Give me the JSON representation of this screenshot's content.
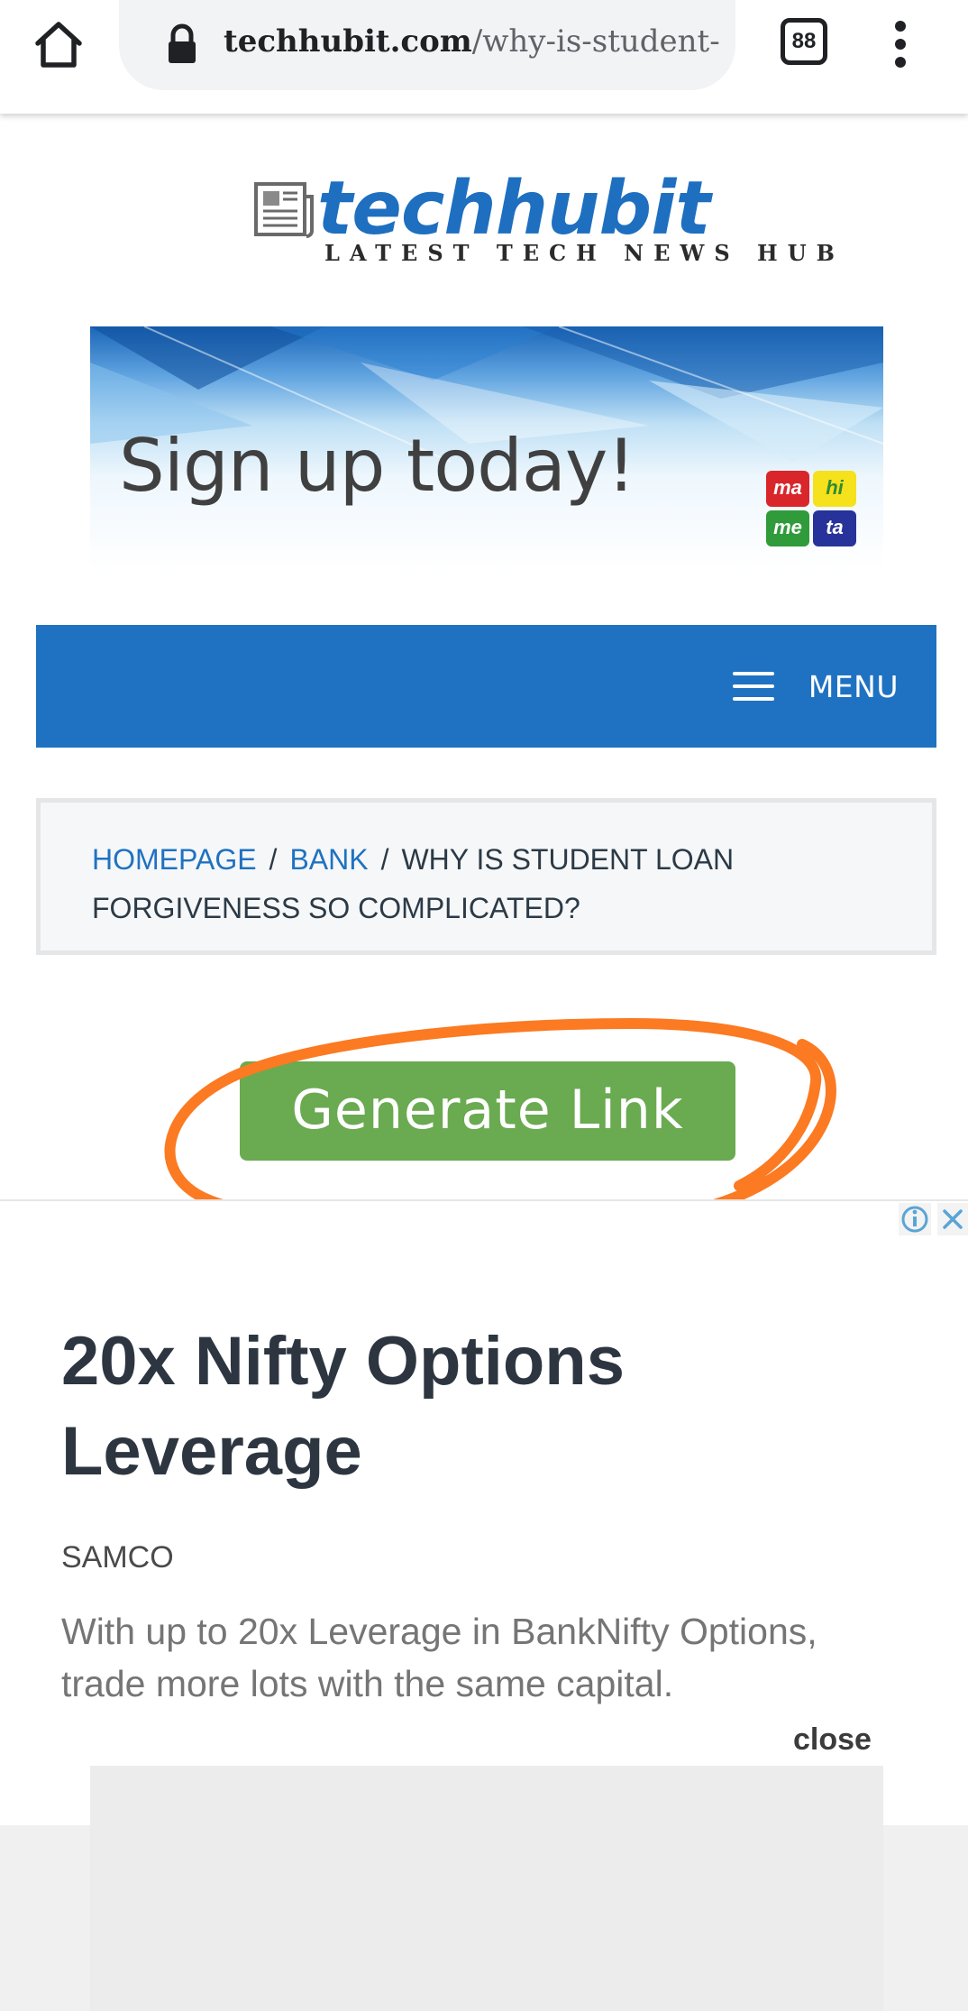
{
  "browser": {
    "url_host": "techhubit.com",
    "url_path": "/why-is-student-",
    "tab_count": "88"
  },
  "site": {
    "logo_name": "techhubit",
    "logo_tagline": "LATEST TECH NEWS HUB"
  },
  "banner": {
    "text": "Sign up today!",
    "logo_tiles": [
      "ma",
      "hi",
      "me",
      "ta"
    ]
  },
  "nav": {
    "menu_label": "MENU"
  },
  "breadcrumb": {
    "items": [
      "HOMEPAGE",
      "BANK"
    ],
    "separator": "/",
    "current_line1": "WHY IS STUDENT LOAN",
    "current_line2": "FORGIVENESS SO COMPLICATED?"
  },
  "content": {
    "generate_button": "Generate Link"
  },
  "ad": {
    "headline_line1": "20x Nifty Options",
    "headline_line2": "Leverage",
    "brand": "SAMCO",
    "description_line1": "With up to 20x Leverage in BankNifty Options,",
    "description_line2": "trade more lots with the same capital.",
    "close_label": "close"
  },
  "colors": {
    "brand_blue": "#1f72c1",
    "generate_green": "#6aaa50",
    "annotation_orange": "#fb7a22",
    "adchoices_blue": "#5ba4d6"
  }
}
